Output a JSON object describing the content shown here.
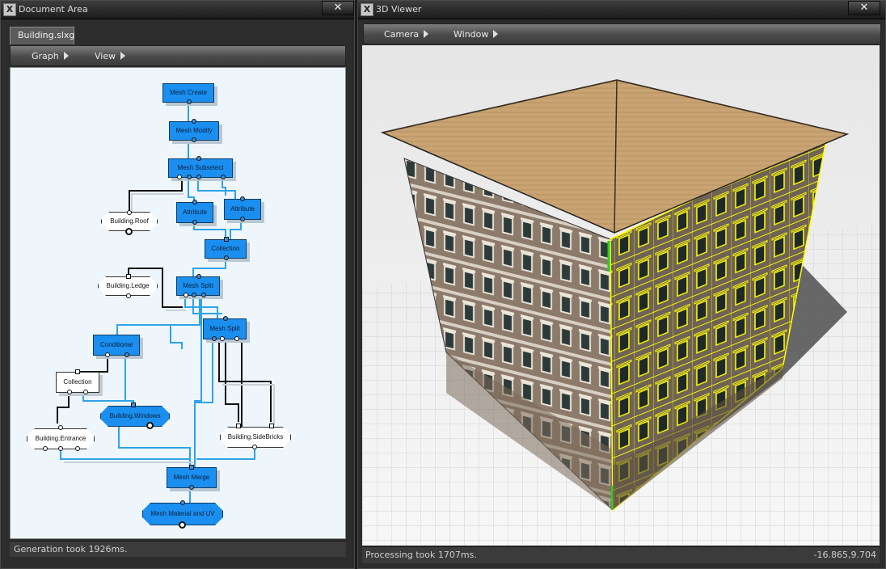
{
  "left_panel": {
    "title": "Document Area",
    "close_label": "✕",
    "tab_label": "Building.slxg",
    "menu": [
      {
        "label": "Graph"
      },
      {
        "label": "View"
      }
    ],
    "status": "Generation took 1926ms."
  },
  "graph": {
    "nodes": {
      "mesh_create": "Mesh Create",
      "mesh_modify": "Mesh Modify",
      "mesh_subselect": "Mesh Subselect",
      "building_roof": "Building.Roof",
      "attribute_1": "Attribute",
      "attribute_2": "Attribute",
      "collection_1": "Collection",
      "building_ledge": "Building.Ledge",
      "mesh_split_1": "Mesh Split",
      "mesh_split_2": "Mesh Split",
      "conditional": "Conditional",
      "collection_2": "Collection",
      "building_windows": "Building.Windows",
      "building_entrance": "Building.Entrance",
      "building_sidebricks": "Building.SideBricks",
      "mesh_merge": "Mesh Merge",
      "mesh_material_uv": "Mesh Material and UV"
    }
  },
  "right_panel": {
    "title": "3D Viewer",
    "close_label": "✕",
    "menu": [
      {
        "label": "Camera"
      },
      {
        "label": "Window"
      }
    ],
    "status": "Processing took 1707ms.",
    "coords": "-16.865,9.704"
  },
  "colors": {
    "node_blue": "#1a8ff0",
    "wire_blue": "#2fa3e6",
    "selection_yellow": "#ffff00",
    "roof": "#c9a472"
  }
}
